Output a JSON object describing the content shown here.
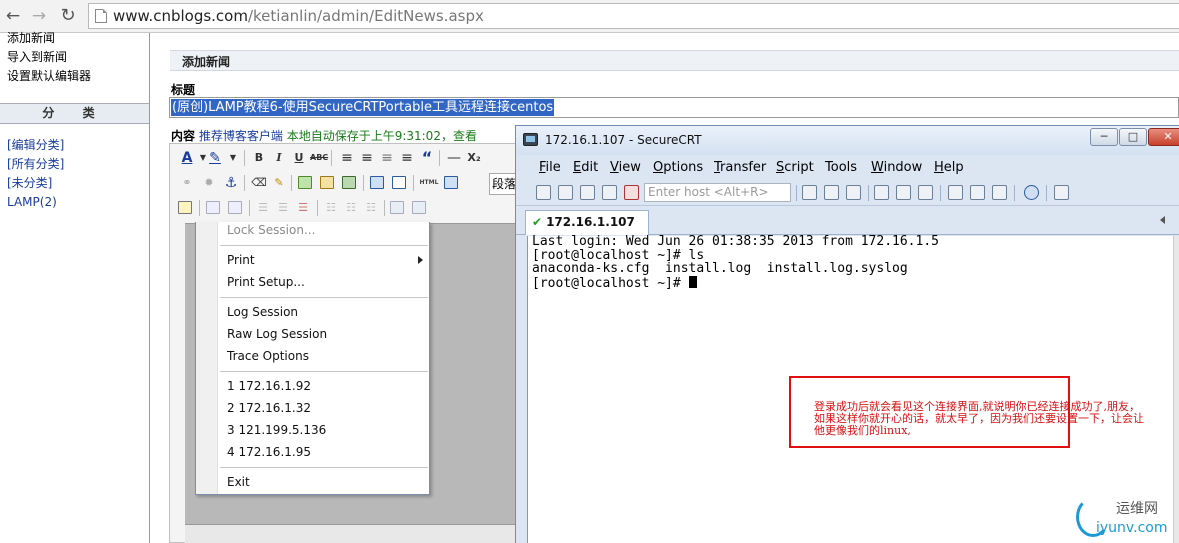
{
  "browser": {
    "url_host": "www.cnblogs.com",
    "url_path": "/ketianlin/admin/EditNews.aspx"
  },
  "sidebar": {
    "links": [
      "添加新闻",
      "导入到新闻",
      "设置默认编辑器"
    ],
    "category_header": "分 类",
    "categories": [
      "[编辑分类]",
      "[所有分类]",
      "[未分类]",
      "LAMP(2)"
    ]
  },
  "main": {
    "section_title": "添加新闻",
    "title_label": "标题",
    "title_value": "(原创)LAMP教程6-使用SecureCRTPortable工具远程连接centos",
    "content_label": "内容",
    "content_link": "推荐博客客户端",
    "autosave_text": "本地自动保存于上午9:31:02，查看",
    "style_dropdown": "段落"
  },
  "menu": {
    "items": {
      "lock_session": "Lock Session...",
      "print": "Print",
      "print_setup": "Print Setup...",
      "log_session": "Log Session",
      "raw_log_session": "Raw Log Session",
      "trace_options": "Trace Options",
      "recent_1": "1 172.16.1.92",
      "recent_2": "2 172.16.1.32",
      "recent_3": "3 121.199.5.136",
      "recent_4": "4 172.16.1.95",
      "exit": "Exit"
    }
  },
  "crt": {
    "window_title": "172.16.1.107 - SecureCRT",
    "menus": [
      {
        "label": "File",
        "u": "F",
        "rest": "ile"
      },
      {
        "label": "Edit",
        "u": "E",
        "rest": "dit"
      },
      {
        "label": "View",
        "u": "V",
        "rest": "iew"
      },
      {
        "label": "Options",
        "u": "O",
        "rest": "ptions"
      },
      {
        "label": "Transfer",
        "u": "T",
        "rest": "ransfer"
      },
      {
        "label": "Script",
        "u": "S",
        "rest": "cript"
      },
      {
        "label": "Tools",
        "u": "T",
        "rest": "ools",
        "pre": "",
        "post": ""
      },
      {
        "label": "Window",
        "u": "W",
        "rest": "indow"
      },
      {
        "label": "Help",
        "u": "H",
        "rest": "elp"
      }
    ],
    "host_placeholder": "Enter host <Alt+R>",
    "tab_label": "172.16.1.107",
    "terminal": {
      "line1": "Last login: Wed Jun 26 01:38:35 2013 from 172.16.1.5",
      "line2": "[root@localhost ~]# ls",
      "line3": "anaconda-ks.cfg  install.log  install.log.syslog",
      "line4": "[root@localhost ~]# "
    }
  },
  "annotation": {
    "text": "登录成功后就会看见这个连接界面,就说明你已经连接成功了,朋友，如果这样你就开心的话，就太早了，因为我们还要设置一下，让会让他更像我们的linux,"
  },
  "watermark": {
    "title": "运维网",
    "subtitle": "iyunv.com"
  },
  "colors": {
    "selection": "#3166c4",
    "link_blue": "#1a3c9c",
    "autosave_green": "#1b7a1b",
    "annotation_red": "#e01010",
    "watermark_blue": "#1b9ad6"
  }
}
